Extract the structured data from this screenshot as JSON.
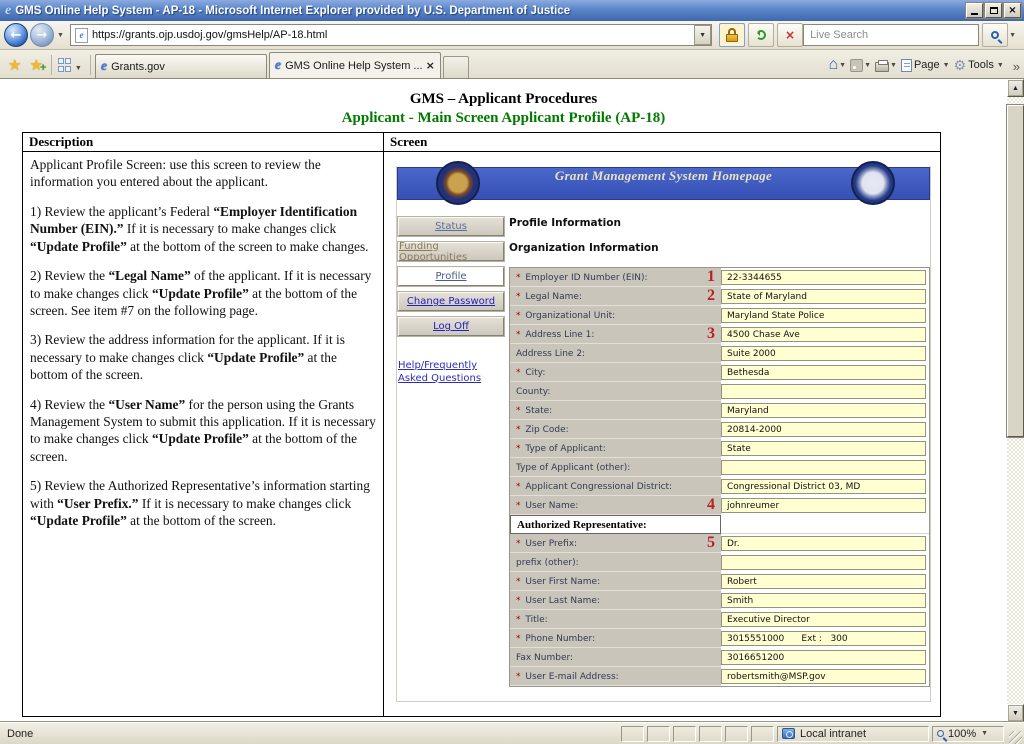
{
  "window": {
    "title": "GMS Online Help System - AP-18 - Microsoft Internet Explorer provided by U.S. Department of Justice"
  },
  "browser": {
    "url": "https://grants.ojp.usdoj.gov/gmsHelp/AP-18.html",
    "search_placeholder": "Live Search",
    "tabs": [
      {
        "label": "Grants.gov",
        "active": false
      },
      {
        "label": "GMS Online Help System ...",
        "active": true
      }
    ],
    "menu": {
      "page": "Page",
      "tools": "Tools"
    },
    "status": {
      "text": "Done",
      "zone": "Local intranet",
      "zoom": "100%"
    }
  },
  "page": {
    "heading1": "GMS – Applicant Procedures",
    "heading2": "Applicant - Main Screen Applicant Profile (AP-18)",
    "columns": {
      "description": "Description",
      "screen": "Screen"
    }
  },
  "colors": {
    "heading2_green": "#007a00",
    "annotation_red": "#bb1f1f",
    "required_red": "#b00000",
    "banner_blue": "#3f5cc3",
    "form_label_bg": "#c9c5bb",
    "form_value_bg": "#ffffd2"
  },
  "description": {
    "paragraphs": [
      [
        {
          "t": "Applicant Profile Screen: use this screen to review the information you entered about the applicant."
        }
      ],
      [
        {
          "t": "1) Review the applicant’s Federal "
        },
        {
          "t": "“Employer Identification Number (EIN).”",
          "b": true
        },
        {
          "t": "  If it is necessary to make changes click "
        },
        {
          "t": "“Update Profile”",
          "b": true
        },
        {
          "t": " at the bottom of the screen to make changes."
        }
      ],
      [
        {
          "t": "2) Review the "
        },
        {
          "t": "“Legal Name”",
          "b": true
        },
        {
          "t": " of the applicant.  If it is necessary to make changes click "
        },
        {
          "t": "“Update Profile”",
          "b": true
        },
        {
          "t": " at the bottom of the screen.   See item #7 on the following page."
        }
      ],
      [
        {
          "t": "3) Review the address information for the applicant. If it is necessary to make changes click "
        },
        {
          "t": "“Update Profile”",
          "b": true
        },
        {
          "t": " at the bottom of the screen."
        }
      ],
      [
        {
          "t": "4) Review the "
        },
        {
          "t": "“User Name”",
          "b": true
        },
        {
          "t": " for the person using the Grants Management System to submit this application.  If it is necessary to make changes click  "
        },
        {
          "t": "“Update Profile”",
          "b": true
        },
        {
          "t": " at the bottom of the screen."
        }
      ],
      [
        {
          "t": "5) Review the Authorized Representative’s information starting with "
        },
        {
          "t": "“User Prefix.”",
          "b": true
        },
        {
          "t": "  If it is necessary to make changes click "
        },
        {
          "t": "“Update Profile”",
          "b": true
        },
        {
          "t": " at the bottom of the screen."
        }
      ]
    ]
  },
  "gms_screen": {
    "banner_title": "Grant Management System Homepage",
    "sidebar": {
      "buttons": [
        {
          "label": "Status",
          "color": "#5a6d9a"
        },
        {
          "label": "Funding Opportunities",
          "color": "#8a7a58"
        },
        {
          "label": "Profile",
          "color": "#4a5a8a",
          "selected": true
        },
        {
          "label": "Change Password",
          "color": "#2222bb"
        },
        {
          "label": "Log Off",
          "color": "#2222bb"
        }
      ],
      "help_link": "Help/Frequently Asked Questions"
    },
    "sections": [
      "Profile Information",
      "Organization Information"
    ],
    "form": {
      "rows": [
        {
          "label": "Employer ID Number (EIN):",
          "req": true,
          "value": "22-3344655",
          "num": "1"
        },
        {
          "label": "Legal Name:",
          "req": true,
          "value": "State of Maryland",
          "num": "2"
        },
        {
          "label": "Organizational Unit:",
          "req": true,
          "value": "Maryland State Police"
        },
        {
          "label": "Address Line 1:",
          "req": true,
          "value": "4500 Chase Ave",
          "num": "3"
        },
        {
          "label": "Address Line 2:",
          "value": "Suite 2000"
        },
        {
          "label": "City:",
          "req": true,
          "value": "Bethesda"
        },
        {
          "label": "County:",
          "value": ""
        },
        {
          "label": "State:",
          "req": true,
          "value": "Maryland"
        },
        {
          "label": "Zip Code:",
          "req": true,
          "value": "20814-2000"
        },
        {
          "label": "Type of Applicant:",
          "req": true,
          "value": "State"
        },
        {
          "label": "Type of Applicant (other):",
          "value": ""
        },
        {
          "label": "Applicant Congressional District:",
          "req": true,
          "value": "Congressional District 03, MD"
        },
        {
          "label": "User Name:",
          "req": true,
          "value": "johnreumer",
          "num": "4"
        },
        {
          "label": "Authorized Representative:",
          "header": true
        },
        {
          "label": "User Prefix:",
          "req": true,
          "value": "Dr.",
          "num": "5"
        },
        {
          "label": "prefix (other):",
          "value": ""
        },
        {
          "label": "User First Name:",
          "req": true,
          "value": "Robert"
        },
        {
          "label": "User Last Name:",
          "req": true,
          "value": "Smith"
        },
        {
          "label": "Title:",
          "req": true,
          "value": "Executive Director"
        },
        {
          "label": "Phone Number:",
          "req": true,
          "value": "3015551000      Ext :   300"
        },
        {
          "label": "Fax Number:",
          "value": "3016651200"
        },
        {
          "label": "User E-mail Address:",
          "req": true,
          "value": "robertsmith@MSP.gov"
        }
      ]
    }
  }
}
